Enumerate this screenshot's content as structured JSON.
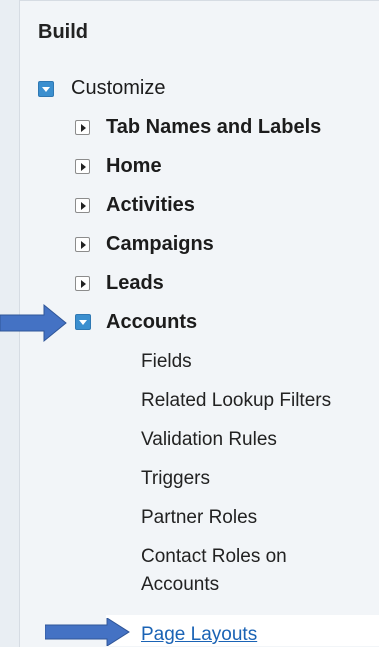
{
  "sidebar": {
    "section_title": "Build",
    "customize": {
      "label": "Customize",
      "expanded": true
    },
    "items": [
      {
        "label": "Tab Names and Labels",
        "expanded": false
      },
      {
        "label": "Home",
        "expanded": false
      },
      {
        "label": "Activities",
        "expanded": false
      },
      {
        "label": "Campaigns",
        "expanded": false
      },
      {
        "label": "Leads",
        "expanded": false
      },
      {
        "label": "Accounts",
        "expanded": true
      }
    ],
    "accounts_children": [
      "Fields",
      "Related Lookup Filters",
      "Validation Rules",
      "Triggers",
      "Partner Roles",
      "Contact Roles on",
      "Accounts",
      "Page Layouts"
    ]
  },
  "annotations": {
    "arrow_color": "#4472c4"
  }
}
